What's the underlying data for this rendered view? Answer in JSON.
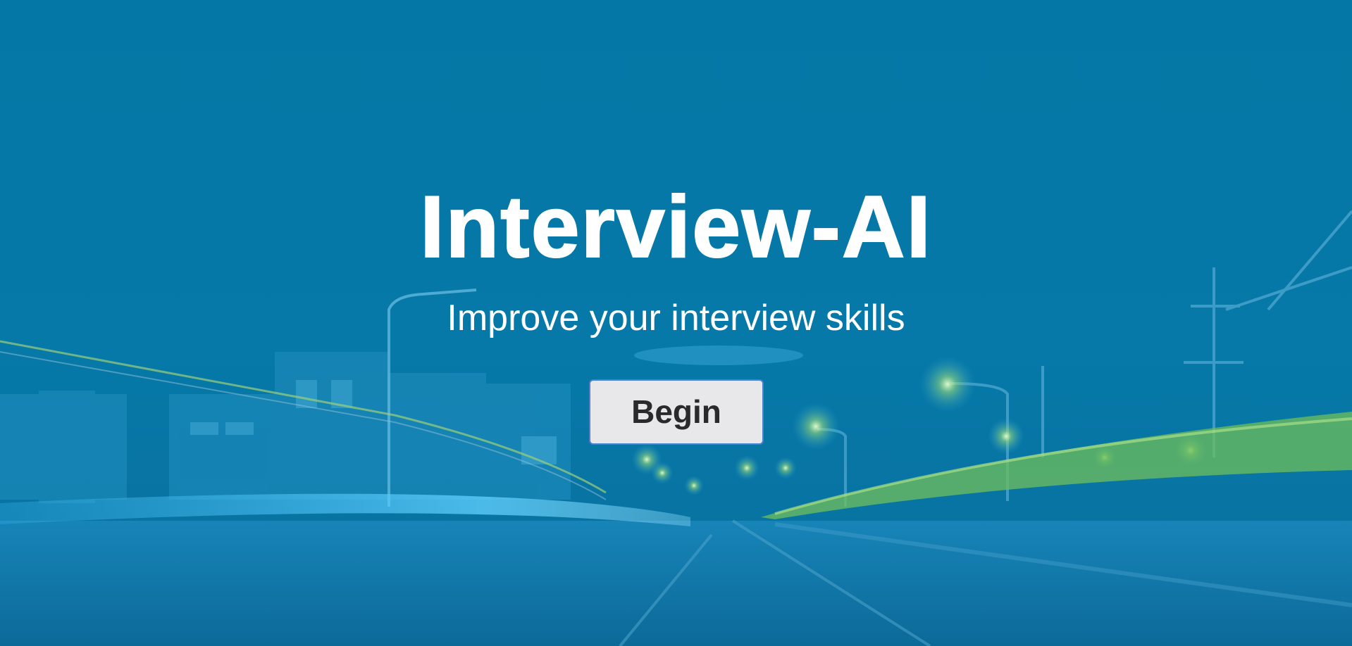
{
  "hero": {
    "title": "Interview-AI",
    "subtitle": "Improve your interview skills",
    "begin_label": "Begin"
  },
  "colors": {
    "background_overlay": "#0679a8",
    "title_text": "#ffffff",
    "button_background": "#e8e8ea",
    "button_border": "#4f7fd0",
    "button_text": "#2a2a2a",
    "light_trail_blue": "#39b6ef",
    "light_trail_green": "#6fbf5a"
  },
  "background": {
    "scene": "night-street-light-trails"
  }
}
